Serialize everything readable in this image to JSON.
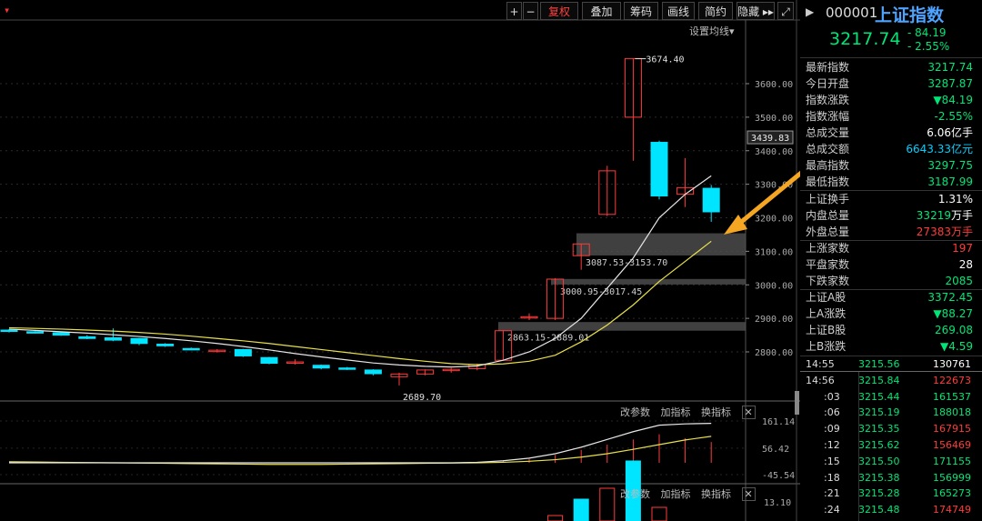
{
  "toolbar": {
    "menu": "▾",
    "buttons": [
      {
        "label": "+"
      },
      {
        "label": "−"
      },
      {
        "label": "复权"
      },
      {
        "label": "叠加"
      },
      {
        "label": "筹码"
      },
      {
        "label": "画线"
      },
      {
        "label": "简约"
      },
      {
        "label": "隐藏 ▸▸"
      },
      {
        "label": "⤢"
      }
    ],
    "ma_settings": "设置均线▾"
  },
  "chart_data": [
    {
      "type": "candlestick",
      "ylim": [
        2760,
        3700
      ],
      "yticks": [
        "3600.00",
        "3500.00",
        "3400.00",
        "3300.00",
        "3200.00",
        "3100.00",
        "3000.00",
        "2900.00",
        "2800.00"
      ],
      "current_price_label": "3439.83",
      "candles": [
        {
          "o": 2865,
          "h": 2868,
          "l": 2858,
          "c": 2862
        },
        {
          "o": 2860,
          "h": 2862,
          "l": 2855,
          "c": 2858
        },
        {
          "o": 2857,
          "h": 2860,
          "l": 2848,
          "c": 2850
        },
        {
          "o": 2845,
          "h": 2850,
          "l": 2838,
          "c": 2840
        },
        {
          "o": 2842,
          "h": 2870,
          "l": 2832,
          "c": 2835
        },
        {
          "o": 2840,
          "h": 2842,
          "l": 2820,
          "c": 2825
        },
        {
          "o": 2823,
          "h": 2826,
          "l": 2815,
          "c": 2818
        },
        {
          "o": 2810,
          "h": 2813,
          "l": 2805,
          "c": 2808
        },
        {
          "o": 2802,
          "h": 2808,
          "l": 2798,
          "c": 2805
        },
        {
          "o": 2807,
          "h": 2809,
          "l": 2785,
          "c": 2788
        },
        {
          "o": 2783,
          "h": 2785,
          "l": 2763,
          "c": 2766
        },
        {
          "o": 2767,
          "h": 2778,
          "l": 2762,
          "c": 2770
        },
        {
          "o": 2760,
          "h": 2762,
          "l": 2748,
          "c": 2752
        },
        {
          "o": 2752,
          "h": 2755,
          "l": 2746,
          "c": 2750
        },
        {
          "o": 2746,
          "h": 2748,
          "l": 2730,
          "c": 2735
        },
        {
          "o": 2726,
          "h": 2738,
          "l": 2700,
          "c": 2734
        },
        {
          "o": 2734,
          "h": 2748,
          "l": 2730,
          "c": 2746
        },
        {
          "o": 2746,
          "h": 2752,
          "l": 2738,
          "c": 2748
        },
        {
          "o": 2750,
          "h": 2765,
          "l": 2745,
          "c": 2762
        },
        {
          "o": 2775,
          "h": 2865,
          "l": 2775,
          "c": 2863
        },
        {
          "o": 2905,
          "h": 2915,
          "l": 2895,
          "c": 2905
        },
        {
          "o": 2900,
          "h": 3020,
          "l": 2895,
          "c": 3017
        },
        {
          "o": 3087,
          "h": 3122,
          "l": 3045,
          "c": 3122
        },
        {
          "o": 3210,
          "h": 3355,
          "l": 3205,
          "c": 3340
        },
        {
          "o": 3500,
          "h": 3674.4,
          "l": 3370,
          "c": 3675
        },
        {
          "o": 3425,
          "h": 3430,
          "l": 3255,
          "c": 3265
        },
        {
          "o": 3270,
          "h": 3378,
          "l": 3232,
          "c": 3290
        },
        {
          "o": 3287.87,
          "h": 3297.75,
          "l": 3187.99,
          "c": 3217.74
        }
      ],
      "ma_white": [
        2868,
        2864,
        2860,
        2856,
        2851,
        2846,
        2840,
        2833,
        2825,
        2816,
        2806,
        2795,
        2785,
        2776,
        2767,
        2761,
        2757,
        2755,
        2758,
        2775,
        2800,
        2840,
        2900,
        2990,
        3080,
        3200,
        3270,
        3325
      ],
      "ma_yellow": [
        2872,
        2870,
        2868,
        2865,
        2862,
        2858,
        2853,
        2847,
        2840,
        2833,
        2825,
        2816,
        2807,
        2798,
        2789,
        2780,
        2772,
        2765,
        2762,
        2764,
        2772,
        2790,
        2830,
        2880,
        2940,
        3010,
        3070,
        3130
      ],
      "gaps": [
        {
          "label": "3087.53-3153.70",
          "low": 3087.53,
          "high": 3153.7
        },
        {
          "label": "3000.95-3017.45",
          "low": 3000.95,
          "high": 3017.45
        },
        {
          "label": "2863.15-2889.01",
          "low": 2863.15,
          "high": 2889.01
        }
      ],
      "high_label": "3674.40",
      "low_label": "2689.70"
    },
    {
      "type": "line",
      "yticks": [
        "161.14",
        "56.42",
        "-45.54"
      ],
      "ylim": [
        -50,
        165
      ],
      "series_white": [
        0,
        0,
        0,
        0,
        0,
        0,
        0,
        0,
        0,
        0,
        0,
        0,
        0,
        0,
        0,
        0,
        0,
        0,
        2,
        8,
        18,
        35,
        60,
        90,
        120,
        145,
        150,
        152
      ],
      "series_yellow": [
        4,
        3,
        2,
        1,
        0,
        -1,
        -2,
        -3,
        -4,
        -5,
        -6,
        -6,
        -6,
        -5,
        -4,
        -3,
        -2,
        -1,
        0,
        2,
        6,
        12,
        22,
        35,
        52,
        70,
        88,
        102
      ],
      "bars": [
        0,
        0,
        0,
        0,
        0,
        0,
        0,
        0,
        0,
        0,
        0,
        0,
        0,
        0,
        0,
        0,
        0,
        0,
        4,
        10,
        15,
        30,
        50,
        70,
        90,
        110,
        95,
        80
      ]
    },
    {
      "type": "bar",
      "yticks": [
        "13.10"
      ],
      "ylim": [
        0,
        14
      ]
    }
  ],
  "indicator_controls": {
    "change": "改参数",
    "add": "加指标",
    "switch": "换指标",
    "close": "✕"
  },
  "quote": {
    "code": "000001",
    "name": "上证指数",
    "price": "3217.74",
    "change": "- 84.19",
    "change_pct": "- 2.55%",
    "rows": [
      {
        "label": "最新指数",
        "value": "3217.74",
        "unit": "",
        "color": "g"
      },
      {
        "label": "今日开盘",
        "value": "3287.87",
        "unit": "",
        "color": "g"
      },
      {
        "label": "指数涨跌",
        "value": "▼84.19",
        "unit": "",
        "color": "g"
      },
      {
        "label": "指数涨幅",
        "value": "-2.55%",
        "unit": "",
        "color": "g"
      },
      {
        "label": "总成交量",
        "value": "6.06",
        "unit": "亿手",
        "color": "w"
      },
      {
        "label": "总成交额",
        "value": "6643.33",
        "unit": "亿元",
        "color": "c"
      },
      {
        "label": "最高指数",
        "value": "3297.75",
        "unit": "",
        "color": "g"
      },
      {
        "label": "最低指数",
        "value": "3187.99",
        "unit": "",
        "color": "g"
      },
      {
        "label": "上证换手",
        "value": "1.31%",
        "unit": "",
        "color": "w"
      },
      {
        "label": "内盘总量",
        "value": "33219",
        "unit": "万手",
        "color": "g"
      },
      {
        "label": "外盘总量",
        "value": "27383",
        "unit": "万手",
        "color": "r"
      },
      {
        "label": "上涨家数",
        "value": "197",
        "unit": "",
        "color": "r"
      },
      {
        "label": "平盘家数",
        "value": "28",
        "unit": "",
        "color": "w"
      },
      {
        "label": "下跌家数",
        "value": "2085",
        "unit": "",
        "color": "g"
      },
      {
        "label": "上证A股",
        "value": "3372.45",
        "unit": "",
        "color": "g"
      },
      {
        "label": "上A涨跌",
        "value": "▼88.27",
        "unit": "",
        "color": "g"
      },
      {
        "label": "上证B股",
        "value": "269.08",
        "unit": "",
        "color": "g"
      },
      {
        "label": "上B涨跌",
        "value": "▼4.59",
        "unit": "",
        "color": "g"
      }
    ],
    "ticks": [
      {
        "time": "14:55",
        "price": "3215.56",
        "vol": "130761",
        "vcolor": "w"
      },
      {
        "time": "14:56",
        "price": "3215.84",
        "vol": "122673",
        "vcolor": "r"
      },
      {
        "time": ":03",
        "price": "3215.44",
        "vol": "161537",
        "vcolor": "g"
      },
      {
        "time": ":06",
        "price": "3215.19",
        "vol": "188018",
        "vcolor": "g"
      },
      {
        "time": ":09",
        "price": "3215.35",
        "vol": "167915",
        "vcolor": "r"
      },
      {
        "time": ":12",
        "price": "3215.62",
        "vol": "156469",
        "vcolor": "r"
      },
      {
        "time": ":15",
        "price": "3215.50",
        "vol": "171155",
        "vcolor": "g"
      },
      {
        "time": ":18",
        "price": "3215.38",
        "vol": "156999",
        "vcolor": "g"
      },
      {
        "time": ":21",
        "price": "3215.28",
        "vol": "165273",
        "vcolor": "g"
      },
      {
        "time": ":24",
        "price": "3215.48",
        "vol": "174749",
        "vcolor": "r"
      }
    ]
  },
  "colors": {
    "up": "#ff3b3b",
    "down": "#00e5ff",
    "ma_white": "#e6e6e6",
    "ma_yellow": "#e8e04a",
    "arrow": "#f5a623",
    "gap": "#555555"
  }
}
